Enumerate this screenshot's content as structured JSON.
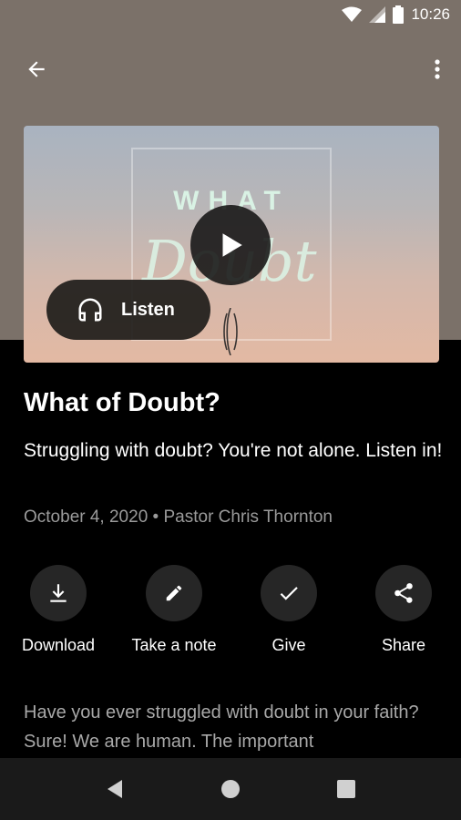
{
  "status_bar": {
    "time": "10:26"
  },
  "artwork": {
    "word": "WHAT",
    "script": "Doubt"
  },
  "listen_button": {
    "label": "Listen"
  },
  "sermon": {
    "title": "What of Doubt?",
    "subtitle": "Struggling with doubt? You're not alone. Listen in!",
    "date": "October 4, 2020",
    "separator": " • ",
    "speaker": "Pastor Chris Thornton",
    "description": "Have you ever struggled with doubt in your faith? Sure! We are human. The important"
  },
  "actions": [
    {
      "label": "Download",
      "icon": "download-icon"
    },
    {
      "label": "Take a note",
      "icon": "pencil-icon"
    },
    {
      "label": "Give",
      "icon": "check-icon"
    },
    {
      "label": "Share",
      "icon": "share-icon"
    }
  ],
  "colors": {
    "header_bg": "#7b7169",
    "page_bg": "#000000",
    "muted_text": "#9a9a9a",
    "action_circle": "#262626"
  }
}
